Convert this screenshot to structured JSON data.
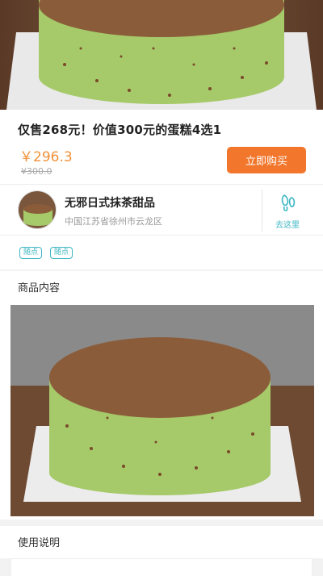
{
  "hero": {
    "image_alt": "matcha cake photo"
  },
  "product": {
    "title": "仅售268元！价值300元的蛋糕4选1",
    "price": "￥296.3",
    "original_price": "¥300.0",
    "buy_label": "立即购买"
  },
  "store": {
    "name": "无邪日式抹茶甜品",
    "address": "中国江苏省徐州市云龙区",
    "visit_label": "去这里"
  },
  "tags": [
    "随点",
    "随点"
  ],
  "sections": {
    "content_title": "商品内容",
    "usage_title": "使用说明"
  },
  "colors": {
    "accent_orange": "#f2772c",
    "price_orange": "#f0923a",
    "teal": "#3db6c2"
  },
  "icons": {
    "visit": "footprint-icon"
  }
}
